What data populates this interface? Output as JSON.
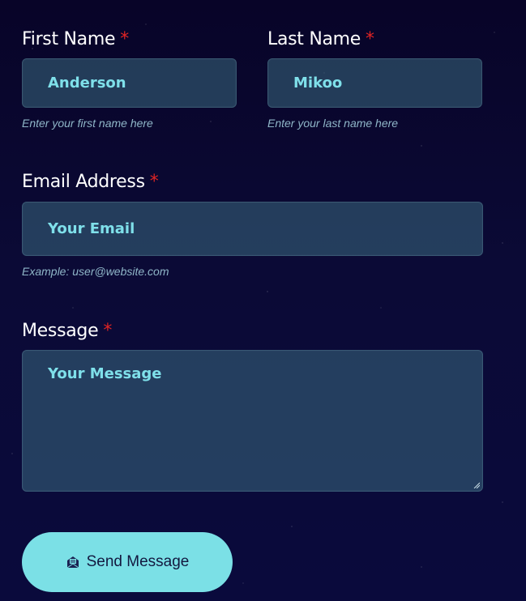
{
  "form": {
    "first_name": {
      "label": "First Name",
      "required_mark": "*",
      "value": "Anderson",
      "hint": "Enter your first name here"
    },
    "last_name": {
      "label": "Last Name",
      "required_mark": "*",
      "value": "Mikoo",
      "hint": "Enter your last name here"
    },
    "email": {
      "label": "Email Address",
      "required_mark": "*",
      "placeholder": "Your Email",
      "hint": "Example: user@website.com"
    },
    "message": {
      "label": "Message",
      "required_mark": "*",
      "placeholder": "Your Message"
    },
    "submit": {
      "label": "Send Message",
      "icon": "envelope-open-icon"
    }
  },
  "colors": {
    "accent": "#7be0e6",
    "required": "#e02424",
    "input_text": "#7fe0ea",
    "background": "#0a0a3c"
  }
}
